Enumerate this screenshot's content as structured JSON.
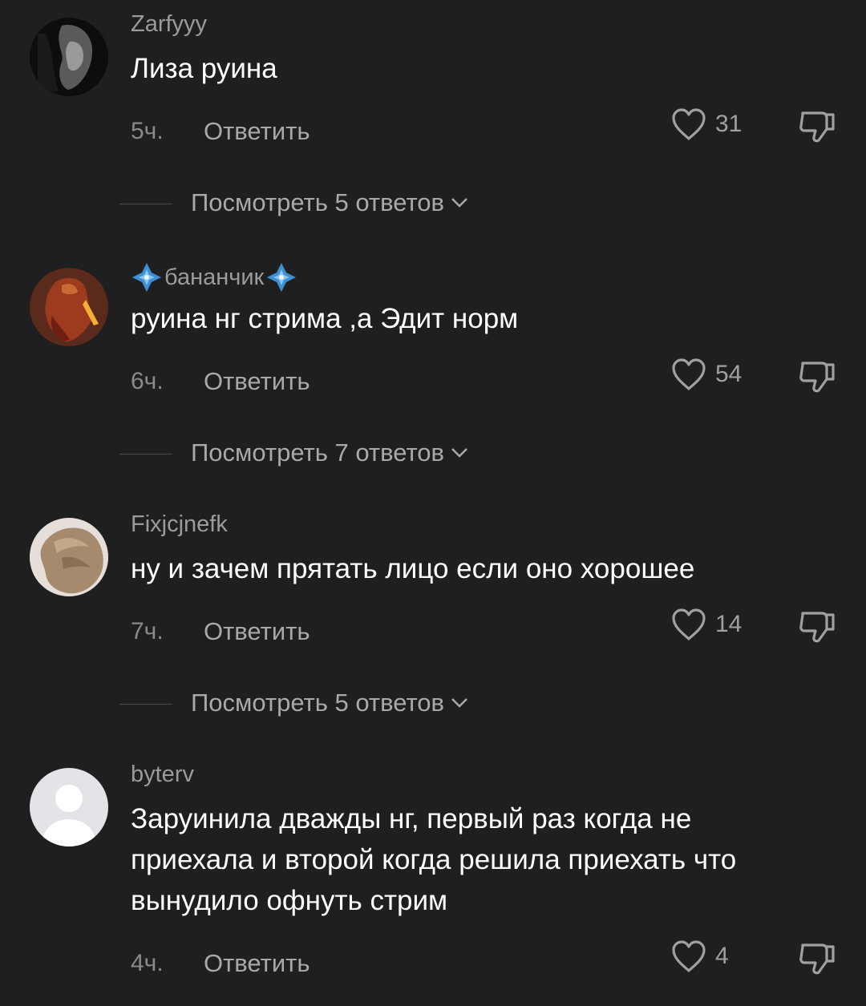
{
  "comments": [
    {
      "username": "Zarfyyy",
      "text": "Лиза руина",
      "time": "5ч.",
      "reply_label": "Ответить",
      "likes": "31",
      "view_replies": "Посмотреть 5 ответов"
    },
    {
      "username": "бананчик",
      "text": "руина нг стрима ,а Эдит норм",
      "time": "6ч.",
      "reply_label": "Ответить",
      "likes": "54",
      "view_replies": "Посмотреть 7 ответов"
    },
    {
      "username": "Fixjcjnefk",
      "text": "ну и зачем прятать лицо если оно хорошее",
      "time": "7ч.",
      "reply_label": "Ответить",
      "likes": "14",
      "view_replies": "Посмотреть 5 ответов"
    },
    {
      "username": "byterv",
      "text": "Заруинила дважды нг, первый раз когда не приехала и второй когда решила приехать что вынудило офнуть стрим",
      "time": "4ч.",
      "reply_label": "Ответить",
      "likes": "4"
    }
  ],
  "icons": {
    "like": "heart-outline-icon",
    "dislike": "thumbs-down-icon",
    "expand": "chevron-down-icon",
    "username_decoration": "blue-diamond-sparkle-icon"
  },
  "colors": {
    "background": "#1f1f1f",
    "username": "#9b9b9b",
    "comment_text": "#ffffff",
    "secondary": "#a9a9a9"
  }
}
